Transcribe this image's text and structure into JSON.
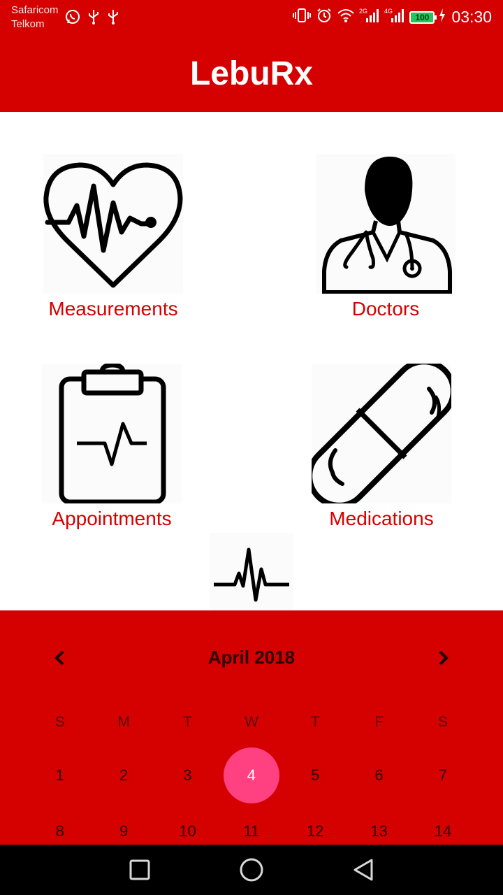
{
  "status_bar": {
    "carrier1": "Safaricom",
    "carrier2": "Telkom",
    "battery": "100",
    "time": "03:30",
    "left_icons": [
      "whatsapp-icon",
      "usb-icon",
      "usb-icon"
    ],
    "right_icons": [
      "vibrate-icon",
      "alarm-icon",
      "wifi-icon",
      "signal-2g-icon",
      "signal-4g-icon"
    ]
  },
  "app": {
    "title": "LebuRx",
    "accent_color": "#d50000",
    "highlight_color": "#ff4081"
  },
  "tiles": [
    {
      "label": "Measurements",
      "icon": "heart-pulse-icon"
    },
    {
      "label": "Doctors",
      "icon": "doctor-icon"
    },
    {
      "label": "Appointments",
      "icon": "clipboard-icon"
    },
    {
      "label": "Medications",
      "icon": "pill-icon"
    }
  ],
  "calendar": {
    "month": "April 2018",
    "weekdays": [
      "S",
      "M",
      "T",
      "W",
      "T",
      "F",
      "S"
    ],
    "weeks": [
      [
        "1",
        "2",
        "3",
        "4",
        "5",
        "6",
        "7"
      ],
      [
        "8",
        "9",
        "10",
        "11",
        "12",
        "13",
        "14"
      ]
    ],
    "selected": "4"
  }
}
